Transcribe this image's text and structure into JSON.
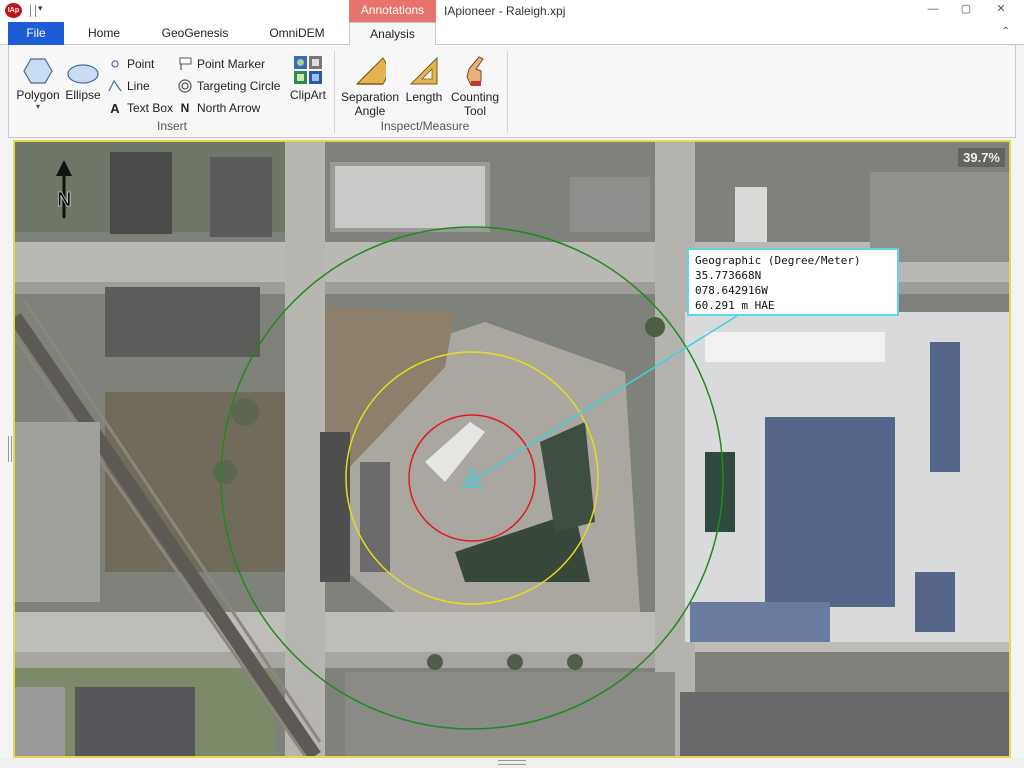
{
  "window": {
    "title": "IApioneer - Raleigh.xpj",
    "context_tab": "Annotations",
    "app_icon_text": "IAp",
    "qa_dropdown": "▾",
    "minimize": "—",
    "maximize": "▢",
    "close": "✕"
  },
  "tabs": [
    {
      "label": "File"
    },
    {
      "label": "Home"
    },
    {
      "label": "GeoGenesis"
    },
    {
      "label": "OmniDEM"
    },
    {
      "label": "Analysis"
    }
  ],
  "collapse_glyph": "⌃",
  "ribbon": {
    "insert": {
      "label": "Insert",
      "polygon": "Polygon",
      "ellipse": "Ellipse",
      "point": "Point",
      "line": "Line",
      "text_box": "Text Box",
      "point_marker": "Point Marker",
      "targeting_circle": "Targeting Circle",
      "north_arrow": "North Arrow",
      "clipart": "ClipArt"
    },
    "inspect": {
      "label": "Inspect/Measure",
      "separation_angle_1": "Separation",
      "separation_angle_2": "Angle",
      "length": "Length",
      "counting_1": "Counting",
      "counting_2": "Tool"
    }
  },
  "map": {
    "zoom": "39.7%",
    "north_label": "N",
    "callout": {
      "line1": "Geographic (Degree/Meter)",
      "line2": "35.773668N",
      "line3": "078.642916W",
      "line4": "60.291 m HAE"
    },
    "colors": {
      "outer_ring": "#1f8a1f",
      "middle_ring": "#e6dc1e",
      "inner_ring": "#e01e1e",
      "leader": "#3fd0e0"
    }
  }
}
